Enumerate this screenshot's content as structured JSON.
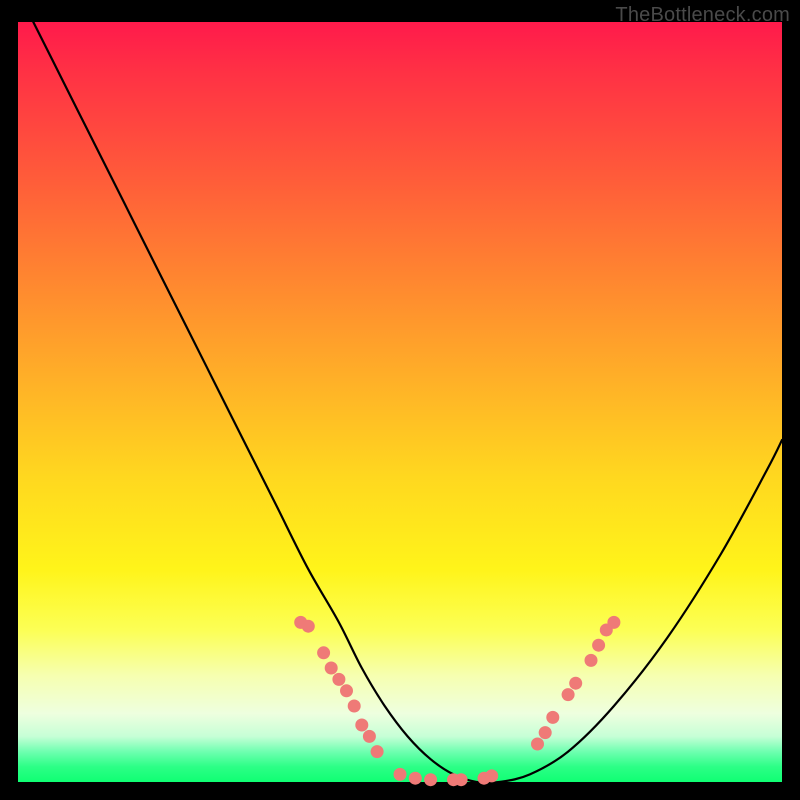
{
  "watermark": "TheBottleneck.com",
  "colors": {
    "dot": "#ef7a77",
    "line": "#000000",
    "frame": "#000000"
  },
  "chart_data": {
    "type": "line",
    "title": "",
    "xlabel": "",
    "ylabel": "",
    "xlim": [
      0,
      100
    ],
    "ylim": [
      0,
      100
    ],
    "grid": false,
    "legend": false,
    "series": [
      {
        "name": "bottleneck-curve",
        "x": [
          2,
          6,
          10,
          14,
          18,
          22,
          26,
          30,
          34,
          38,
          42,
          45,
          48,
          51,
          54,
          57,
          60,
          63,
          67,
          72,
          78,
          85,
          92,
          98,
          100
        ],
        "y": [
          100,
          92,
          84,
          76,
          68,
          60,
          52,
          44,
          36,
          28,
          21,
          15,
          10,
          6,
          3,
          1,
          0,
          0,
          1,
          4,
          10,
          19,
          30,
          41,
          45
        ]
      }
    ],
    "annotations": {
      "dots_name": "highlight-dots",
      "dots": [
        {
          "x": 37,
          "y": 21.0
        },
        {
          "x": 38,
          "y": 20.5
        },
        {
          "x": 40,
          "y": 17.0
        },
        {
          "x": 41,
          "y": 15.0
        },
        {
          "x": 42,
          "y": 13.5
        },
        {
          "x": 43,
          "y": 12.0
        },
        {
          "x": 44,
          "y": 10.0
        },
        {
          "x": 45,
          "y": 7.5
        },
        {
          "x": 46,
          "y": 6.0
        },
        {
          "x": 47,
          "y": 4.0
        },
        {
          "x": 50,
          "y": 1.0
        },
        {
          "x": 52,
          "y": 0.5
        },
        {
          "x": 54,
          "y": 0.3
        },
        {
          "x": 57,
          "y": 0.3
        },
        {
          "x": 58,
          "y": 0.3
        },
        {
          "x": 61,
          "y": 0.5
        },
        {
          "x": 62,
          "y": 0.8
        },
        {
          "x": 68,
          "y": 5.0
        },
        {
          "x": 69,
          "y": 6.5
        },
        {
          "x": 70,
          "y": 8.5
        },
        {
          "x": 72,
          "y": 11.5
        },
        {
          "x": 73,
          "y": 13.0
        },
        {
          "x": 75,
          "y": 16.0
        },
        {
          "x": 76,
          "y": 18.0
        },
        {
          "x": 77,
          "y": 20.0
        },
        {
          "x": 78,
          "y": 21.0
        }
      ]
    }
  }
}
